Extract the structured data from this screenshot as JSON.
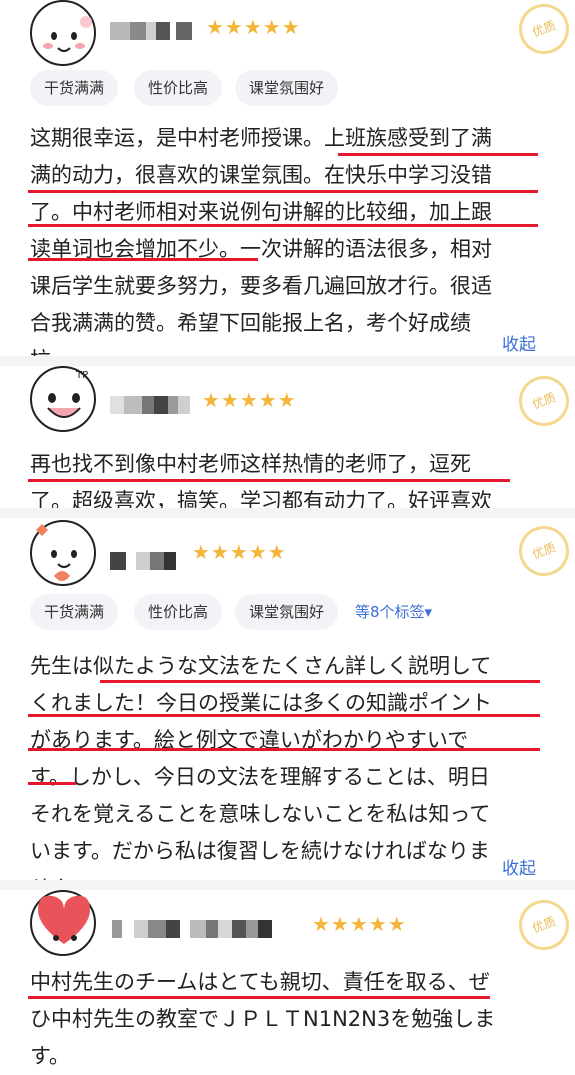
{
  "reviews": [
    {
      "rating": "★★★★★",
      "stamp": "优质",
      "tags": [
        "干货满满",
        "性价比高",
        "课堂氛围好"
      ],
      "lines": [
        "这期很幸运，是中村老师授课。上班族感受到了满",
        "满的动力，很喜欢的课堂氛围。在快乐中学习没错",
        "了。中村老师相对来说例句讲解的比较细，加上跟",
        "读单词也会增加不少。一次讲解的语法很多，相对",
        "课后学生就要多努力，要多看几遍回放才行。很适",
        "合我满满的赞。希望下回能报上名，考个好成绩",
        "拉。"
      ],
      "collapse": "收起"
    },
    {
      "rating": "★★★★★",
      "stamp": "优质",
      "lines": [
        "再也找不到像中村老师这样热情的老师了，逗死",
        "了。超级喜欢，搞笑。学习都有动力了。好评喜欢"
      ]
    },
    {
      "rating": "★★★★★",
      "stamp": "优质",
      "tags": [
        "干货满满",
        "性价比高",
        "课堂氛围好"
      ],
      "more_tags": "等8个标签▾",
      "lines": [
        "先生は似たような文法をたくさん詳しく説明して",
        "くれました！今日の授業には多くの知識ポイント",
        "があります。絵と例文で違いがわかりやすいで",
        "す。しかし、今日の文法を理解することは、明日",
        "それを覚えることを意味しないことを私は知って",
        "います。だから私は復習しを続けなければなりま",
        "せん。"
      ],
      "collapse": "收起"
    },
    {
      "rating": "★★★★★",
      "stamp": "优质",
      "lines": [
        "中村先生のチームはとても親切、責任を取る、ぜ",
        "ひ中村先生の教室でＪＰＬＴN1N2N3を勉強しま",
        "す。"
      ]
    }
  ],
  "colors": {
    "underline": "#e3182d",
    "link": "#3b6fd6",
    "star": "#f4b63a",
    "tag_bg": "#f1f3f6"
  }
}
